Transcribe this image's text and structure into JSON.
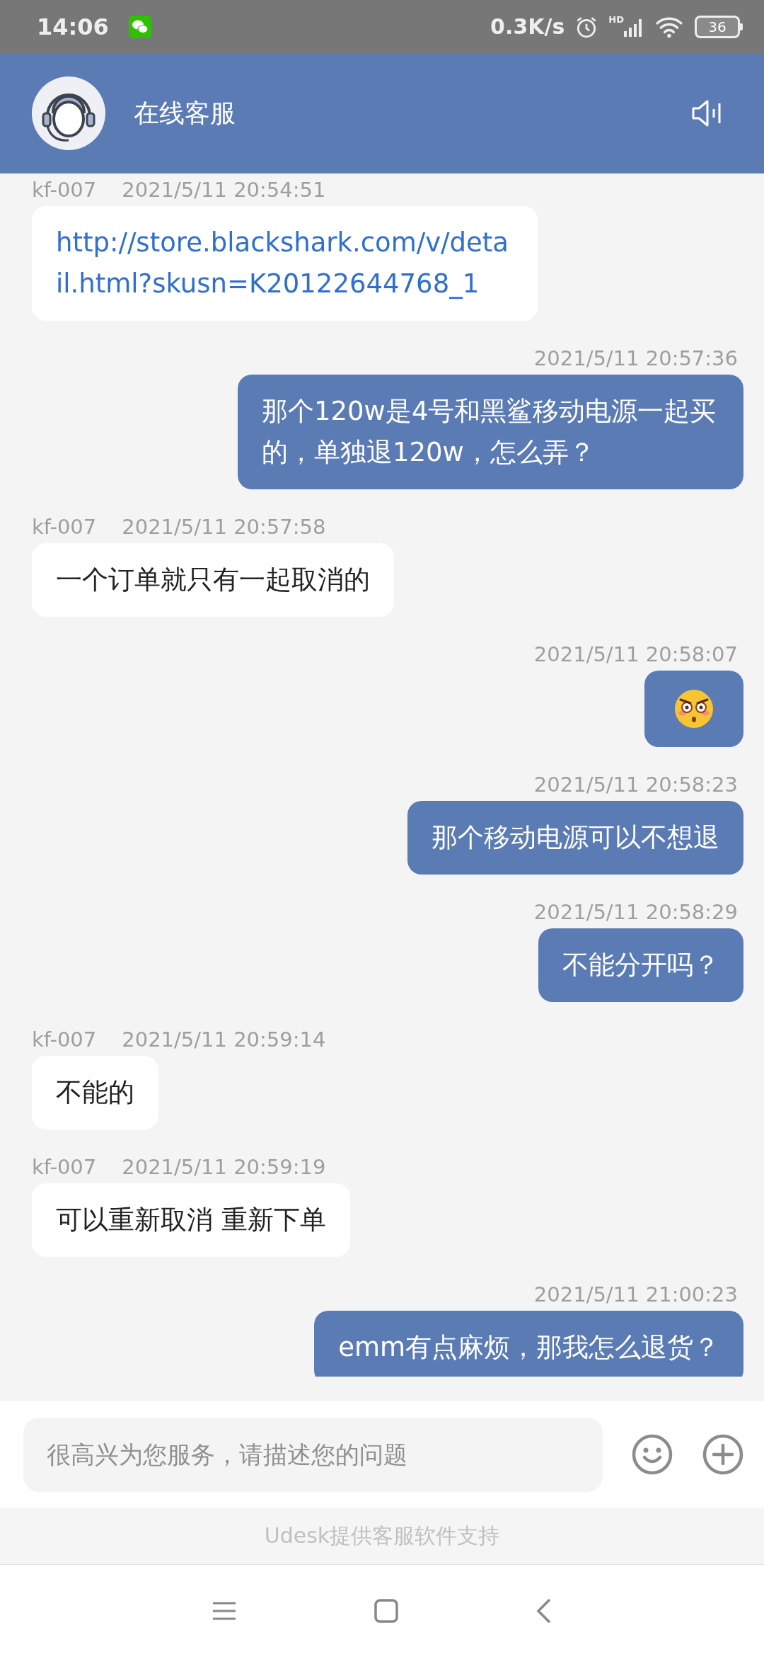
{
  "status_bar": {
    "time": "14:06",
    "speed": "0.3K/s",
    "network": "HD",
    "battery": "36"
  },
  "header": {
    "title": "在线客服"
  },
  "messages": [
    {
      "outgoing": false,
      "kind": "link",
      "sender": "kf-007",
      "time": "2021/5/11 20:54:51",
      "text": "http://store.blackshark.com/v/detail.html?skusn=K20122644768_1"
    },
    {
      "outgoing": true,
      "kind": "text",
      "time": "2021/5/11 20:57:36",
      "text": "那个120w是4号和黑鲨移动电源一起买的，单独退120w，怎么弄？"
    },
    {
      "outgoing": false,
      "kind": "text",
      "sender": "kf-007",
      "time": "2021/5/11 20:57:58",
      "text": "一个订单就只有一起取消的"
    },
    {
      "outgoing": true,
      "kind": "emoji",
      "time": "2021/5/11 20:58:07"
    },
    {
      "outgoing": true,
      "kind": "text",
      "time": "2021/5/11 20:58:23",
      "text": "那个移动电源可以不想退"
    },
    {
      "outgoing": true,
      "kind": "text",
      "time": "2021/5/11 20:58:29",
      "text": "不能分开吗？"
    },
    {
      "outgoing": false,
      "kind": "text",
      "sender": "kf-007",
      "time": "2021/5/11 20:59:14",
      "text": "不能的"
    },
    {
      "outgoing": false,
      "kind": "text",
      "sender": "kf-007",
      "time": "2021/5/11 20:59:19",
      "text": "可以重新取消 重新下单"
    },
    {
      "outgoing": true,
      "kind": "text",
      "time": "2021/5/11 21:00:23",
      "text": "emm有点麻烦，那我怎么退货？"
    }
  ],
  "composer": {
    "placeholder": "很高兴为您服务，请描述您的问题"
  },
  "footer": {
    "text": "Udesk提供客服软件支持"
  }
}
